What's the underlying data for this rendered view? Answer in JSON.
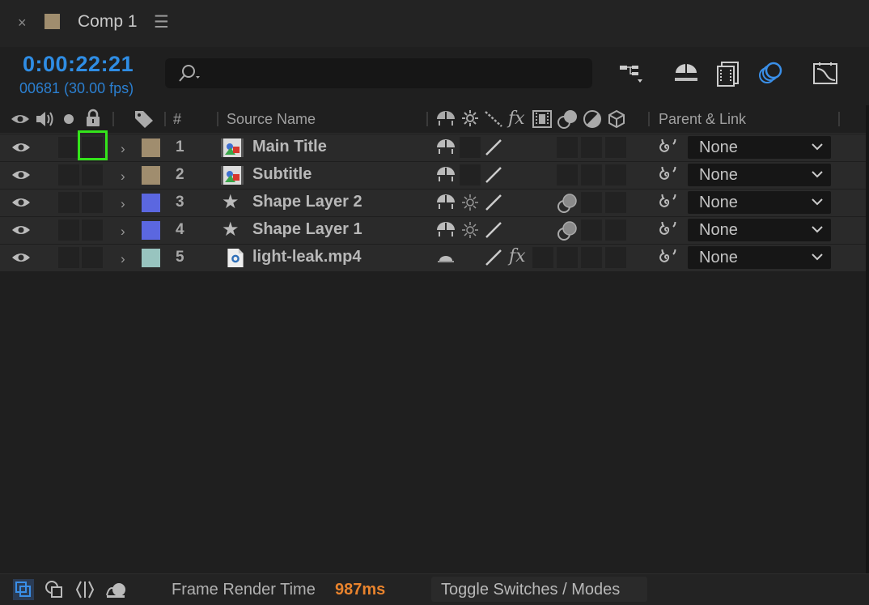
{
  "tab": {
    "close": "×",
    "title": "Comp 1",
    "menu": "☰",
    "swatch_color": "#a08d6e"
  },
  "time": {
    "timecode": "0:00:22:21",
    "frames": "00681 (30.00 fps)"
  },
  "search": {
    "value": "",
    "placeholder": ""
  },
  "header": {
    "number": "#",
    "source_name": "Source Name",
    "parent_link": "Parent & Link"
  },
  "layers": [
    {
      "number": "1",
      "name": "Main Title",
      "type": "precomp",
      "color": "#a08d6e",
      "parent": "None",
      "switch_fx": false,
      "has_blend": false
    },
    {
      "number": "2",
      "name": "Subtitle",
      "type": "precomp",
      "color": "#a08d6e",
      "parent": "None",
      "switch_fx": false,
      "has_blend": false
    },
    {
      "number": "3",
      "name": "Shape Layer 2",
      "type": "shape",
      "color": "#5b67e0",
      "parent": "None",
      "switch_fx": false,
      "has_blend": true
    },
    {
      "number": "4",
      "name": "Shape Layer 1",
      "type": "shape",
      "color": "#5b67e0",
      "parent": "None",
      "switch_fx": false,
      "has_blend": true
    },
    {
      "number": "5",
      "name": "light-leak.mp4",
      "type": "footage",
      "color": "#98c4bf",
      "parent": "None",
      "switch_fx": true,
      "has_blend": false
    }
  ],
  "footer": {
    "frame_render_label": "Frame Render Time",
    "frame_render_value": "987ms",
    "toggle_label": "Toggle Switches / Modes"
  },
  "colors": {
    "accent": "#2f8de4",
    "render_time": "#e8832d",
    "highlight": "#34e41b"
  }
}
